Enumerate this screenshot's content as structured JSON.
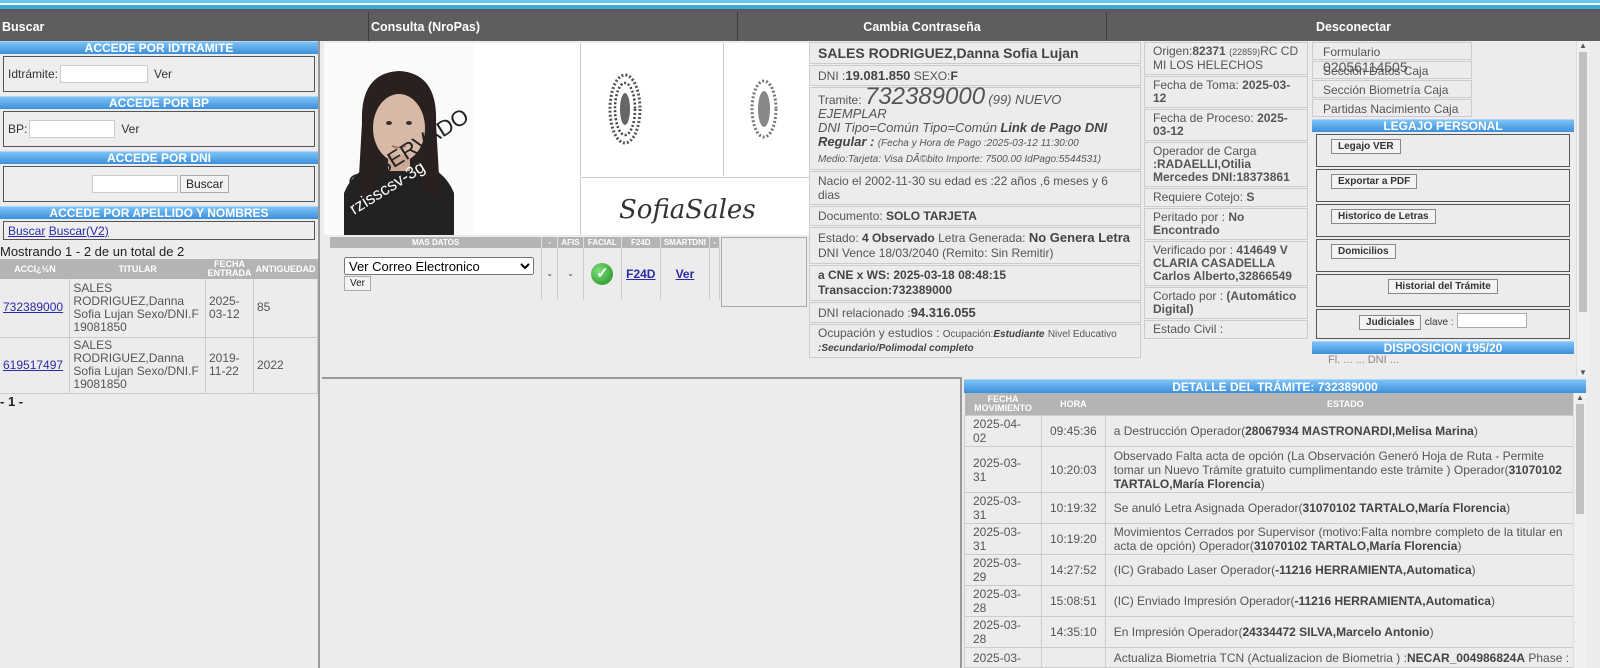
{
  "nav": {
    "buscar": "Buscar",
    "consulta": "Consulta (NroPas)",
    "cambia": "Cambia Contraseña",
    "desconectar": "Desconectar"
  },
  "left": {
    "idtramite_header": "ACCEDE POR IDTRAMITE",
    "idtramite_label": "Idtrámite:",
    "ver1": "Ver",
    "bp_header": "ACCEDE POR BP",
    "bp_label": "BP:",
    "ver2": "Ver",
    "dni_header": "ACCEDE POR DNI",
    "buscar_btn": "Buscar",
    "apellido_header": "ACCEDE POR APELLIDO Y NOMBRES",
    "buscar_link": "Buscar",
    "buscar_v2_link": "Buscar(V2)",
    "showing": "Mostrando 1 - 2 de un total de 2",
    "columns": [
      "ACCI¿½N",
      "TITULAR",
      "FECHA ENTRADA",
      "ANTIGUEDAD"
    ],
    "rows": [
      {
        "accion": "732389000",
        "titular": "SALES RODRIGUEZ,Danna Sofia Lujan Sexo/DNI.F 19081850",
        "fecha": "2025-03-12",
        "antiguedad": "85"
      },
      {
        "accion": "619517497",
        "titular": "SALES RODRIGUEZ,Danna Sofia Lujan Sexo/DNI.F 19081850",
        "fecha": "2019-11-22",
        "antiguedad": "2022"
      }
    ],
    "pager": "- 1 -"
  },
  "photo": {
    "stamp1": "OBSERVADO",
    "stamp2": "rzisscsv-3g",
    "signature": "SofiaSales"
  },
  "masdatos": {
    "columns": [
      "MAS DATOS",
      "-",
      "AFIS",
      "FACIAL",
      "F24D",
      "SMARTDNI",
      "-"
    ],
    "select_value": "Ver Correo Electronico",
    "ver": "Ver",
    "dash1": "-",
    "dash2": "-",
    "f24d": "F24D",
    "smartdni": "Ver"
  },
  "info": {
    "name": "SALES RODRIGUEZ,Danna Sofia Lujan",
    "dni_label": "DNI :",
    "dni": "19.081.850",
    "sexo_label": "SEXO:",
    "sexo": "F",
    "tramite_label": "Tramite:",
    "tramite": "732389000",
    "tramite_suffix": "(99) NUEVO EJEMPLAR",
    "dni_tipo": "DNI Tipo=Común Tipo=Común",
    "link_pago": "Link de Pago DNI Regular :",
    "pago_detail": "(Fecha y Hora de Pago :2025-03-12 11:30:00",
    "medio": "Medio:Tarjeta: Visa DÃ©bito Importe: 7500.00 IdPago:5544531)",
    "nacio": "Nacio el 2002-11-30 su edad es :22 años ,6 meses y 6 dias",
    "documento_label": "Documento:",
    "documento": "SOLO TARJETA",
    "estado_label": "Estado:",
    "estado": "4 Observado",
    "letra_label": "Letra Generada:",
    "letra": "No Genera Letra",
    "vence": "DNI Vence 18/03/2040 (Remito: Sin Remitir)",
    "cne": "a CNE x WS: 2025-03-18 08:48:15",
    "transaccion": "Transaccion:732389000",
    "relacionado_label": "DNI relacionado :",
    "relacionado": "94.316.055",
    "ocupacion_label": "Ocupación y estudios :",
    "ocupacion_small": "Ocupación:",
    "ocupacion": "Estudiante",
    "nivel_label": "Nivel Educativo",
    "nivel": ":Secundario/Polimodal completo"
  },
  "col3": {
    "origen_label": "Origen:",
    "origen": "82371",
    "origen_small": "(22859)",
    "origen_rest": "RC CD MI LOS HELECHOS",
    "toma_label": "Fecha de Toma:",
    "toma": "2025-03-12",
    "proceso_label": "Fecha de Proceso:",
    "proceso": "2025-03-12",
    "operador_label": "Operador de Carga",
    "operador": ":RADAELLI,Otilia Mercedes DNI:18373861",
    "cotejo_label": "Requiere Cotejo:",
    "cotejo": "S",
    "peritado_label": "Peritado por :",
    "peritado": "No Encontrado",
    "verificado_label": "Verificado por :",
    "verificado": "414649 V CLARIA CASADELLA Carlos Alberto,32866549",
    "cortado_label": "Cortado por :",
    "cortado": "(Automático Digital)",
    "civil": "Estado Civil :"
  },
  "col4": {
    "formulario_label": "Formulario",
    "formulario": "02056114505",
    "seccion_datos": "Sección Datos Caja",
    "seccion_bio": "Sección Biometría Caja",
    "partidas": "Partidas Nacimiento Caja",
    "legajo_header": "LEGAJO PERSONAL",
    "legajo_ver": "Legajo VER",
    "exportar": "Exportar a PDF",
    "historico": "Historico de Letras",
    "domicilios": "Domicilios",
    "historial": "Historial del Trámite",
    "judiciales": "Judiciales",
    "clave": "clave :",
    "disposicion_header": "DISPOSICION 195/20",
    "cut_text": "Fl. ...   ... DNI ..."
  },
  "detail": {
    "header": "DETALLE DEL TRÁMITE: 732389000",
    "columns": [
      "FECHA MOVIMIENTO",
      "HORA",
      "ESTADO"
    ],
    "rows": [
      {
        "fecha": "2025-04-02",
        "hora": "09:45:36",
        "text": "a Destrucción Operador(",
        "bold": "28067934 MASTRONARDI,Melisa Marina",
        "tail": ")"
      },
      {
        "fecha": "2025-03-31",
        "hora": "10:20:03",
        "text": "Observado Falta acta de opción (La Observación Generó Hoja de Ruta - Permite tomar un Nuevo Trámite gratuito cumplimentando este trámite ) Operador(",
        "bold": "31070102 TARTALO,María Florencia",
        "tail": ")"
      },
      {
        "fecha": "2025-03-31",
        "hora": "10:19:32",
        "text": "Se anuló Letra Asignada Operador(",
        "bold": "31070102 TARTALO,María Florencia",
        "tail": ")"
      },
      {
        "fecha": "2025-03-31",
        "hora": "10:19:20",
        "text": "Movimientos Cerrados por Supervisor (motivo:Falta nombre completo de la titular en acta de opción) Operador(",
        "bold": "31070102 TARTALO,María Florencia",
        "tail": ")"
      },
      {
        "fecha": "2025-03-29",
        "hora": "14:27:52",
        "text": "(IC) Grabado Laser Operador(",
        "bold": "-11216 HERRAMIENTA,Automatica",
        "tail": ")"
      },
      {
        "fecha": "2025-03-28",
        "hora": "15:08:51",
        "text": "(IC) Enviado Impresión Operador(",
        "bold": "-11216 HERRAMIENTA,Automatica",
        "tail": ")"
      },
      {
        "fecha": "2025-03-28",
        "hora": "14:35:10",
        "text": "En Impresión Operador(",
        "bold": "24334472 SILVA,Marcelo Antonio",
        "tail": ")"
      },
      {
        "fecha": "2025-03-",
        "hora": "",
        "text": "Actualiza Biometria TCN (Actualizacion de Biometria ) :",
        "bold": "NECAR_004986824A",
        "tail": " Phase :"
      }
    ]
  },
  "colors": {
    "nav": "#5e5e5e",
    "header_blue": "#3d8fdb",
    "link": "#2a2aa8"
  }
}
